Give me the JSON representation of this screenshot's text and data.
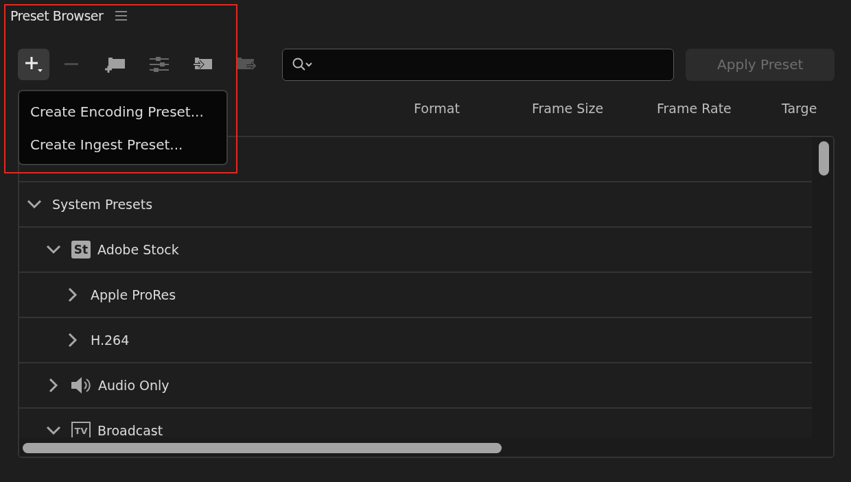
{
  "panel": {
    "title": "Preset Browser"
  },
  "toolbar": {
    "apply_button": {
      "label": "Apply Preset",
      "disabled": true
    }
  },
  "add_menu": {
    "items": [
      "Create Encoding Preset...",
      "Create Ingest Preset..."
    ]
  },
  "columns": [
    "Format",
    "Frame Size",
    "Frame Rate",
    "Targe"
  ],
  "tree": [
    {
      "label": "System Presets",
      "expanded": true,
      "children": [
        {
          "label": "Adobe Stock",
          "expanded": true,
          "kind": "stock",
          "badge": "St",
          "children": [
            {
              "label": "Apple ProRes",
              "expanded": false
            },
            {
              "label": "H.264",
              "expanded": false
            }
          ]
        },
        {
          "label": "Audio Only",
          "expanded": false,
          "kind": "audio"
        },
        {
          "label": "Broadcast",
          "expanded": true,
          "kind": "tv",
          "badge": "TV"
        }
      ]
    }
  ]
}
